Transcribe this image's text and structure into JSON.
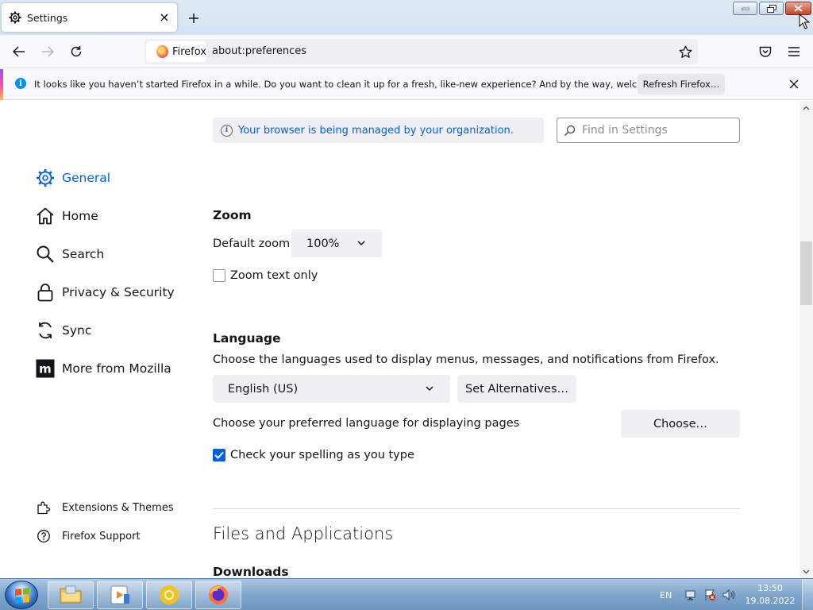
{
  "tab": {
    "title": "Settings"
  },
  "navbar": {
    "identity_label": "Firefox",
    "url": "about:preferences"
  },
  "notification": {
    "message": "It looks like you haven’t started Firefox in a while. Do you want to clean it up for a fresh, like-new experience? And by the way, welcome back!",
    "button_label": "Refresh Firefox…",
    "info_glyph": "i"
  },
  "managed_notice": {
    "text": "Your browser is being managed by your organization.",
    "icon_glyph": "i"
  },
  "search": {
    "placeholder": "Find in Settings"
  },
  "sidebar": {
    "categories": [
      {
        "label": "General",
        "icon": "gear-icon",
        "selected": true
      },
      {
        "label": "Home",
        "icon": "home-icon"
      },
      {
        "label": "Search",
        "icon": "search-icon"
      },
      {
        "label": "Privacy & Security",
        "icon": "lock-icon"
      },
      {
        "label": "Sync",
        "icon": "sync-icon"
      },
      {
        "label": "More from Mozilla",
        "icon": "mozilla-icon"
      }
    ],
    "links": [
      {
        "label": "Extensions & Themes",
        "icon": "puzzle-icon"
      },
      {
        "label": "Firefox Support",
        "icon": "help-icon"
      }
    ]
  },
  "zoom": {
    "heading": "Zoom",
    "default_label": "Default zoom",
    "default_value": "100%",
    "text_only_label": "Zoom text only",
    "text_only_checked": false
  },
  "language": {
    "heading": "Language",
    "description": "Choose the languages used to display menus, messages, and notifications from Firefox.",
    "selected": "English (US)",
    "alternatives_label": "Set Alternatives…",
    "pages_label": "Choose your preferred language for displaying pages",
    "choose_label": "Choose…",
    "spellcheck_label": "Check your spelling as you type",
    "spellcheck_checked": true
  },
  "files": {
    "heading": "Files and Applications",
    "downloads_heading": "Downloads"
  },
  "taskbar": {
    "language": "EN",
    "time": "13:50",
    "date": "19.08.2022",
    "apps": [
      "file-explorer-icon",
      "media-player-icon",
      "chrome-icon",
      "firefox-icon"
    ]
  },
  "colors": {
    "accent": "#0061e0",
    "notification_info": "#0090ed"
  }
}
